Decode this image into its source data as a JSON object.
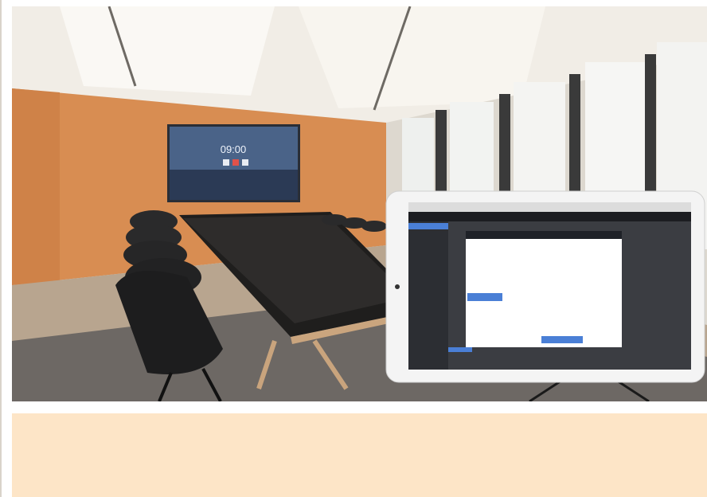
{
  "photo": {
    "tv": {
      "clock_text": "09:00"
    }
  },
  "colors": {
    "accent_wall": "#d88d52",
    "banner_fill": "#fde5c7",
    "tablet_highlight": "#4a7fd6"
  }
}
